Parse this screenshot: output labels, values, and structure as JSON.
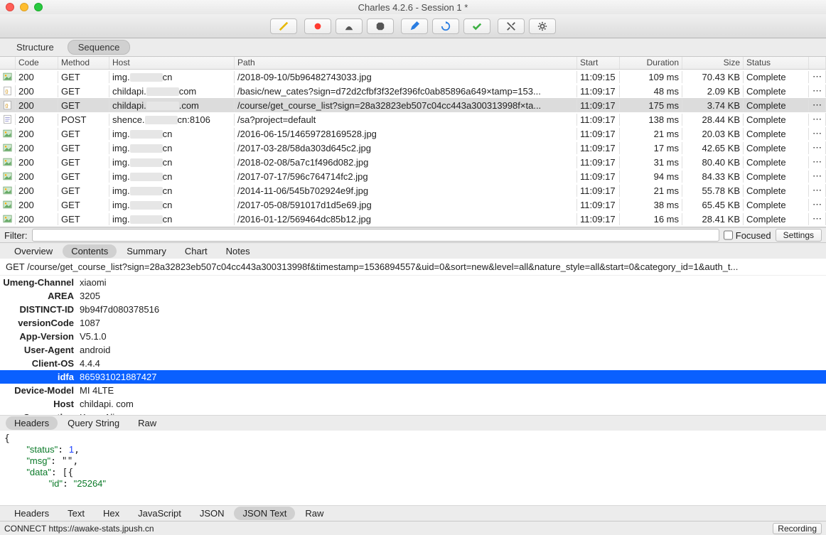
{
  "window": {
    "title": "Charles 4.2.6 - Session 1 *"
  },
  "toolbar_icons": [
    "broom",
    "record",
    "lock",
    "stop",
    "pencil",
    "refresh",
    "check",
    "wrench",
    "gear"
  ],
  "view_tabs": {
    "items": [
      "Structure",
      "Sequence"
    ],
    "active": 1
  },
  "columns": [
    "",
    "Code",
    "Method",
    "Host",
    "Path",
    "Start",
    "Duration",
    "Size",
    "Status",
    ""
  ],
  "rows": [
    {
      "icon": "img",
      "code": "200",
      "method": "GET",
      "host_pre": "img.",
      "host_suf": "cn",
      "path": "/2018-09-10/5b96482743033.jpg",
      "start": "11:09:15",
      "dur": "109 ms",
      "size": "70.43 KB",
      "status": "Complete"
    },
    {
      "icon": "json",
      "code": "200",
      "method": "GET",
      "host_pre": "childapi.",
      "host_suf": "com",
      "path": "/basic/new_cates?sign=d72d2cfbf3f32ef396fc0ab85896a649&timestamp=153...",
      "start": "11:09:17",
      "dur": "48 ms",
      "size": "2.09 KB",
      "status": "Complete"
    },
    {
      "icon": "json",
      "code": "200",
      "method": "GET",
      "host_pre": "childapi.",
      "host_suf": ".com",
      "path": "/course/get_course_list?sign=28a32823eb507c04cc443a300313998f&timesta...",
      "start": "11:09:17",
      "dur": "175 ms",
      "size": "3.74 KB",
      "status": "Complete",
      "sel": true
    },
    {
      "icon": "doc",
      "code": "200",
      "method": "POST",
      "host_pre": "shence.",
      "host_suf": "cn:8106",
      "path": "/sa?project=default",
      "start": "11:09:17",
      "dur": "138 ms",
      "size": "28.44 KB",
      "status": "Complete"
    },
    {
      "icon": "img",
      "code": "200",
      "method": "GET",
      "host_pre": "img.",
      "host_suf": "cn",
      "path": "/2016-06-15/14659728169528.jpg",
      "start": "11:09:17",
      "dur": "21 ms",
      "size": "20.03 KB",
      "status": "Complete"
    },
    {
      "icon": "img",
      "code": "200",
      "method": "GET",
      "host_pre": "img.",
      "host_suf": "cn",
      "path": "/2017-03-28/58da303d645c2.jpg",
      "start": "11:09:17",
      "dur": "17 ms",
      "size": "42.65 KB",
      "status": "Complete"
    },
    {
      "icon": "img",
      "code": "200",
      "method": "GET",
      "host_pre": "img.",
      "host_suf": "cn",
      "path": "/2018-02-08/5a7c1f496d082.jpg",
      "start": "11:09:17",
      "dur": "31 ms",
      "size": "80.40 KB",
      "status": "Complete"
    },
    {
      "icon": "img",
      "code": "200",
      "method": "GET",
      "host_pre": "img.",
      "host_suf": "cn",
      "path": "/2017-07-17/596c764714fc2.jpg",
      "start": "11:09:17",
      "dur": "94 ms",
      "size": "84.33 KB",
      "status": "Complete"
    },
    {
      "icon": "img",
      "code": "200",
      "method": "GET",
      "host_pre": "img.",
      "host_suf": "cn",
      "path": "/2014-11-06/545b702924e9f.jpg",
      "start": "11:09:17",
      "dur": "21 ms",
      "size": "55.78 KB",
      "status": "Complete"
    },
    {
      "icon": "img",
      "code": "200",
      "method": "GET",
      "host_pre": "img.",
      "host_suf": "cn",
      "path": "/2017-05-08/591017d1d5e69.jpg",
      "start": "11:09:17",
      "dur": "38 ms",
      "size": "65.45 KB",
      "status": "Complete"
    },
    {
      "icon": "img",
      "code": "200",
      "method": "GET",
      "host_pre": "img.",
      "host_suf": "cn",
      "path": "/2016-01-12/569464dc85b12.jpg",
      "start": "11:09:17",
      "dur": "16 ms",
      "size": "28.41 KB",
      "status": "Complete"
    }
  ],
  "filter": {
    "label": "Filter:",
    "value": "",
    "focused_label": "Focused",
    "settings": "Settings"
  },
  "detail_tabs": {
    "items": [
      "Overview",
      "Contents",
      "Summary",
      "Chart",
      "Notes"
    ],
    "active": 1
  },
  "request_line": "GET /course/get_course_list?sign=28a32823eb507c04cc443a300313998f&timestamp=1536894557&uid=0&sort=new&level=all&nature_style=all&start=0&category_id=1&auth_t...",
  "headers": [
    {
      "k": "Umeng-Channel",
      "v": "xiaomi"
    },
    {
      "k": "AREA",
      "v": "3205"
    },
    {
      "k": "DISTINCT-ID",
      "v": "9b94f7d080378516"
    },
    {
      "k": "versionCode",
      "v": "1087"
    },
    {
      "k": "App-Version",
      "v": "V5.1.0"
    },
    {
      "k": "User-Agent",
      "v": "android"
    },
    {
      "k": "Client-OS",
      "v": "4.4.4"
    },
    {
      "k": "idfa",
      "v": "865931021887427",
      "sel": true
    },
    {
      "k": "Device-Model",
      "v": "MI 4LTE"
    },
    {
      "k": "Host",
      "v": "childapi.            com"
    },
    {
      "k": "Connection",
      "v": "Keep-Alive"
    }
  ],
  "sub_tabs": {
    "items": [
      "Headers",
      "Query String",
      "Raw"
    ],
    "active": 0
  },
  "body_json": "{\n    \"status\": 1,\n    \"msg\": \"\",\n    \"data\": [{\n        \"id\": \"25264\"",
  "body_tabs": {
    "items": [
      "Headers",
      "Text",
      "Hex",
      "JavaScript",
      "JSON",
      "JSON Text",
      "Raw"
    ],
    "active": 5
  },
  "status": {
    "left": "CONNECT https://awake-stats.jpush.cn",
    "right": "Recording"
  }
}
